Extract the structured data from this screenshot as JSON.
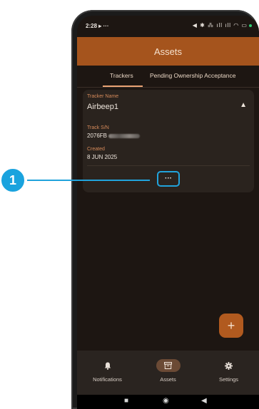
{
  "status_bar": {
    "time": "2:28",
    "left_icons": "▸ ···",
    "right_icons": "◀ ✱ ⁂ ıll ıll ◠ ▭"
  },
  "app_bar": {
    "title": "Assets"
  },
  "tabs": [
    {
      "label": "Trackers",
      "active": true
    },
    {
      "label": "Pending Ownership Acceptance",
      "active": false
    }
  ],
  "tracker_card": {
    "name_label": "Tracker Name",
    "name_value": "Airbeep1",
    "sn_label": "Track S/N",
    "sn_value": "2076FB",
    "created_label": "Created",
    "created_value": "8 JUN 2025",
    "expand_icon": "chevron-up-icon",
    "more_button": "···"
  },
  "fab": {
    "label": "+"
  },
  "bottom_nav": [
    {
      "label": "Notifications",
      "icon": "bell-icon",
      "active": false
    },
    {
      "label": "Assets",
      "icon": "archive-icon",
      "active": true
    },
    {
      "label": "Settings",
      "icon": "gear-icon",
      "active": false
    }
  ],
  "system_nav": {
    "recent": "■",
    "home": "◉",
    "back": "◀"
  },
  "callout": {
    "number": "1"
  },
  "colors": {
    "app_bar": "#a5541d",
    "background": "#1d1612",
    "card": "#2a231e",
    "accent": "#d68a5a",
    "callout": "#21a3dc"
  }
}
